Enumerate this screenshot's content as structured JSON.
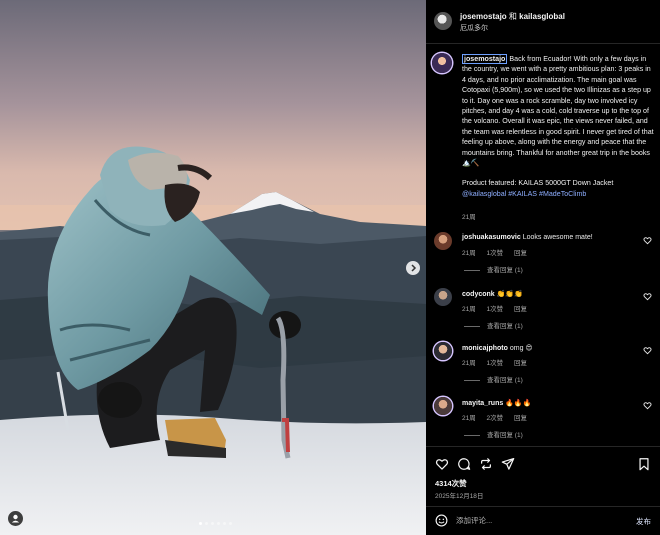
{
  "header": {
    "author": "josemostajo",
    "connector": "和",
    "coauthor": "kailasglobal",
    "location": "厄瓜多尔"
  },
  "caption": {
    "username": "josemostajo",
    "text": "Back from Ecuador! With only a few days in the country, we went with a pretty ambitious plan: 3 peaks in 4 days, and no prior acclimatization. The main goal was Cotopaxi (5,900m), so we used the two Illinizas as a step up to it. Day one was a rock scramble, day two involved icy pitches, and day 4 was a cold, cold traverse up to the top of the volcano. Overall it was epic, the views never failed, and the team was relentless in good spirit. I never get tired of that feeling up above, along with the energy and peace that the mountains bring. Thankful for another great trip in the books 🏔️⛏️",
    "product": "Product featured: KAILAS 5000GT Down Jacket",
    "tags": "@kailasglobal #KAILAS #MadeToClimb",
    "time": "21周"
  },
  "comments": [
    {
      "user": "joshuakasumovic",
      "text": "Looks awesome mate!",
      "time": "21周",
      "likes": "1次赞",
      "reply": "回复",
      "view_replies": "查看回复 (1)"
    },
    {
      "user": "codyconk",
      "text": "👏👏👏",
      "time": "21周",
      "likes": "1次赞",
      "reply": "回复",
      "view_replies": "查看回复 (1)"
    },
    {
      "user": "monicajphoto",
      "text": "omg 😍",
      "time": "21周",
      "likes": "1次赞",
      "reply": "回复",
      "view_replies": "查看回复 (1)"
    },
    {
      "user": "mayita_runs",
      "text": "🔥🔥🔥",
      "time": "21周",
      "likes": "2次赞",
      "reply": "回复",
      "view_replies": "查看回复 (1)"
    }
  ],
  "post": {
    "likes": "4314次赞",
    "date": "2025年12月18日",
    "comment_placeholder": "添加评论...",
    "post_label": "发布"
  },
  "carousel": {
    "total": 6,
    "current": 1
  },
  "icons": {
    "like": "heart-icon",
    "comment": "comment-icon",
    "share": "repost-icon",
    "send": "send-icon",
    "save": "bookmark-icon",
    "emoji": "emoji-icon",
    "next": "chevron-right-icon",
    "tagged_users": "user-icon"
  },
  "colors": {
    "background": "#000000",
    "text": "#f5f5f5",
    "muted": "#a8a8a8",
    "link": "#8eaeff"
  }
}
